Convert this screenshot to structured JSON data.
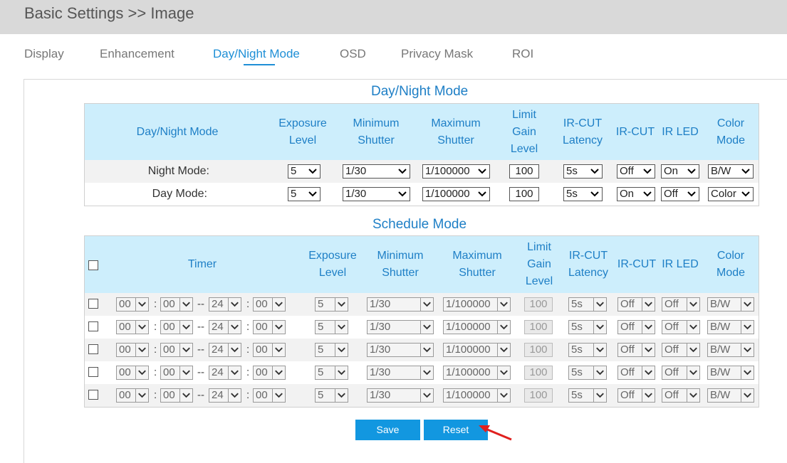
{
  "header": {
    "title": "Basic Settings >> Image"
  },
  "tabs": [
    {
      "label": "Display",
      "active": false
    },
    {
      "label": "Enhancement",
      "active": false
    },
    {
      "label": "Day/Night Mode",
      "active": true
    },
    {
      "label": "OSD",
      "active": false
    },
    {
      "label": "Privacy Mask",
      "active": false
    },
    {
      "label": "ROI",
      "active": false
    }
  ],
  "daynight": {
    "title": "Day/Night Mode",
    "headers": {
      "mode": "Day/Night Mode",
      "exposure": [
        "Exposure",
        "Level"
      ],
      "min_shutter": [
        "Minimum",
        "Shutter"
      ],
      "max_shutter": [
        "Maximum",
        "Shutter"
      ],
      "limit_gain": [
        "Limit",
        "Gain",
        "Level"
      ],
      "ircut_latency": [
        "IR-CUT",
        "Latency"
      ],
      "ircut": "IR-CUT",
      "irled": "IR LED",
      "color_mode": [
        "Color",
        "Mode"
      ]
    },
    "rows": [
      {
        "label": "Night Mode:",
        "exposure": "5",
        "min_shutter": "1/30",
        "max_shutter": "1/100000",
        "gain": "100",
        "latency": "5s",
        "ircut": "Off",
        "irled": "On",
        "color": "B/W"
      },
      {
        "label": "Day Mode:",
        "exposure": "5",
        "min_shutter": "1/30",
        "max_shutter": "1/100000",
        "gain": "100",
        "latency": "5s",
        "ircut": "On",
        "irled": "Off",
        "color": "Color"
      }
    ]
  },
  "schedule": {
    "title": "Schedule Mode",
    "headers": {
      "timer": "Timer",
      "exposure": [
        "Exposure",
        "Level"
      ],
      "min_shutter": [
        "Minimum",
        "Shutter"
      ],
      "max_shutter": [
        "Maximum",
        "Shutter"
      ],
      "limit_gain": [
        "Limit",
        "Gain",
        "Level"
      ],
      "ircut_latency": [
        "IR-CUT",
        "Latency"
      ],
      "ircut": "IR-CUT",
      "irled": "IR LED",
      "color_mode": [
        "Color",
        "Mode"
      ]
    },
    "time_sep": ":",
    "range_sep": "--",
    "rows": [
      {
        "h1": "00",
        "m1": "00",
        "h2": "24",
        "m2": "00",
        "exposure": "5",
        "min_shutter": "1/30",
        "max_shutter": "1/100000",
        "gain": "100",
        "latency": "5s",
        "ircut": "Off",
        "irled": "Off",
        "color": "B/W"
      },
      {
        "h1": "00",
        "m1": "00",
        "h2": "24",
        "m2": "00",
        "exposure": "5",
        "min_shutter": "1/30",
        "max_shutter": "1/100000",
        "gain": "100",
        "latency": "5s",
        "ircut": "Off",
        "irled": "Off",
        "color": "B/W"
      },
      {
        "h1": "00",
        "m1": "00",
        "h2": "24",
        "m2": "00",
        "exposure": "5",
        "min_shutter": "1/30",
        "max_shutter": "1/100000",
        "gain": "100",
        "latency": "5s",
        "ircut": "Off",
        "irled": "Off",
        "color": "B/W"
      },
      {
        "h1": "00",
        "m1": "00",
        "h2": "24",
        "m2": "00",
        "exposure": "5",
        "min_shutter": "1/30",
        "max_shutter": "1/100000",
        "gain": "100",
        "latency": "5s",
        "ircut": "Off",
        "irled": "Off",
        "color": "B/W"
      },
      {
        "h1": "00",
        "m1": "00",
        "h2": "24",
        "m2": "00",
        "exposure": "5",
        "min_shutter": "1/30",
        "max_shutter": "1/100000",
        "gain": "100",
        "latency": "5s",
        "ircut": "Off",
        "irled": "Off",
        "color": "B/W"
      }
    ]
  },
  "actions": {
    "save": "Save",
    "reset": "Reset"
  },
  "colors": {
    "accent": "#1e8fd6",
    "header_bg": "#cdeefc",
    "button": "#1297e0",
    "annotation_arrow": "#e0201e"
  }
}
